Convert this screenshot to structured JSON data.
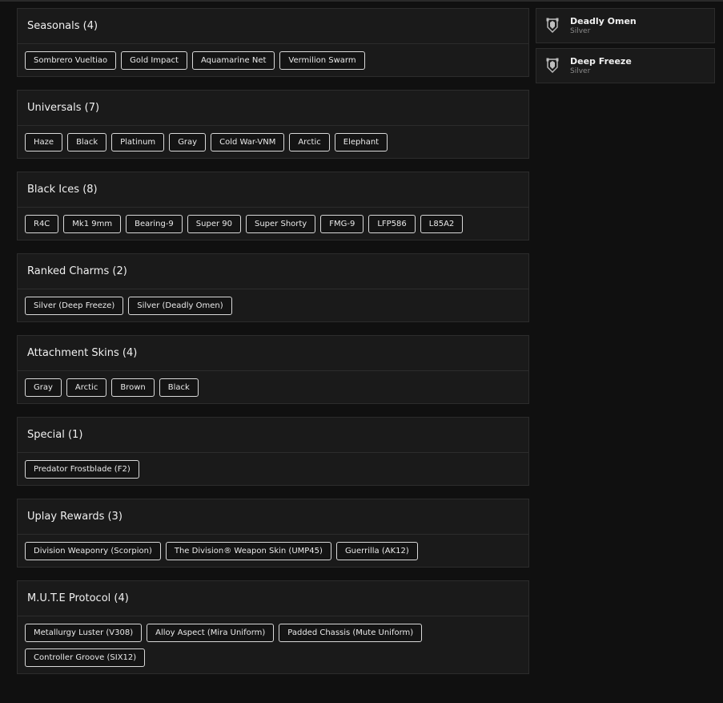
{
  "sections": [
    {
      "title": "Seasonals (4)",
      "items": [
        "Sombrero Vueltiao",
        "Gold Impact",
        "Aquamarine Net",
        "Vermilion Swarm"
      ]
    },
    {
      "title": "Universals (7)",
      "items": [
        "Haze",
        "Black",
        "Platinum",
        "Gray",
        "Cold War-VNM",
        "Arctic",
        "Elephant"
      ]
    },
    {
      "title": "Black Ices (8)",
      "items": [
        "R4C",
        "Mk1 9mm",
        "Bearing-9",
        "Super 90",
        "Super Shorty",
        "FMG-9",
        "LFP586",
        "L85A2"
      ]
    },
    {
      "title": "Ranked Charms (2)",
      "items": [
        "Silver (Deep Freeze)",
        "Silver (Deadly Omen)"
      ]
    },
    {
      "title": "Attachment Skins (4)",
      "items": [
        "Gray",
        "Arctic",
        "Brown",
        "Black"
      ]
    },
    {
      "title": "Special (1)",
      "items": [
        "Predator Frostblade (F2)"
      ]
    },
    {
      "title": "Uplay Rewards (3)",
      "items": [
        "Division Weaponry (Scorpion)",
        "The Division® Weapon Skin (UMP45)",
        "Guerrilla (AK12)"
      ]
    },
    {
      "title": "M.U.T.E Protocol (4)",
      "items": [
        "Metallurgy Luster (V308)",
        "Alloy Aspect (Mira Uniform)",
        "Padded Chassis (Mute Uniform)",
        "Controller Groove (SIX12)"
      ]
    }
  ],
  "charms": [
    {
      "name": "Deadly Omen",
      "rank": "Silver",
      "icon": "rank-badge-icon"
    },
    {
      "name": "Deep Freeze",
      "rank": "Silver",
      "icon": "rank-badge-icon"
    }
  ]
}
